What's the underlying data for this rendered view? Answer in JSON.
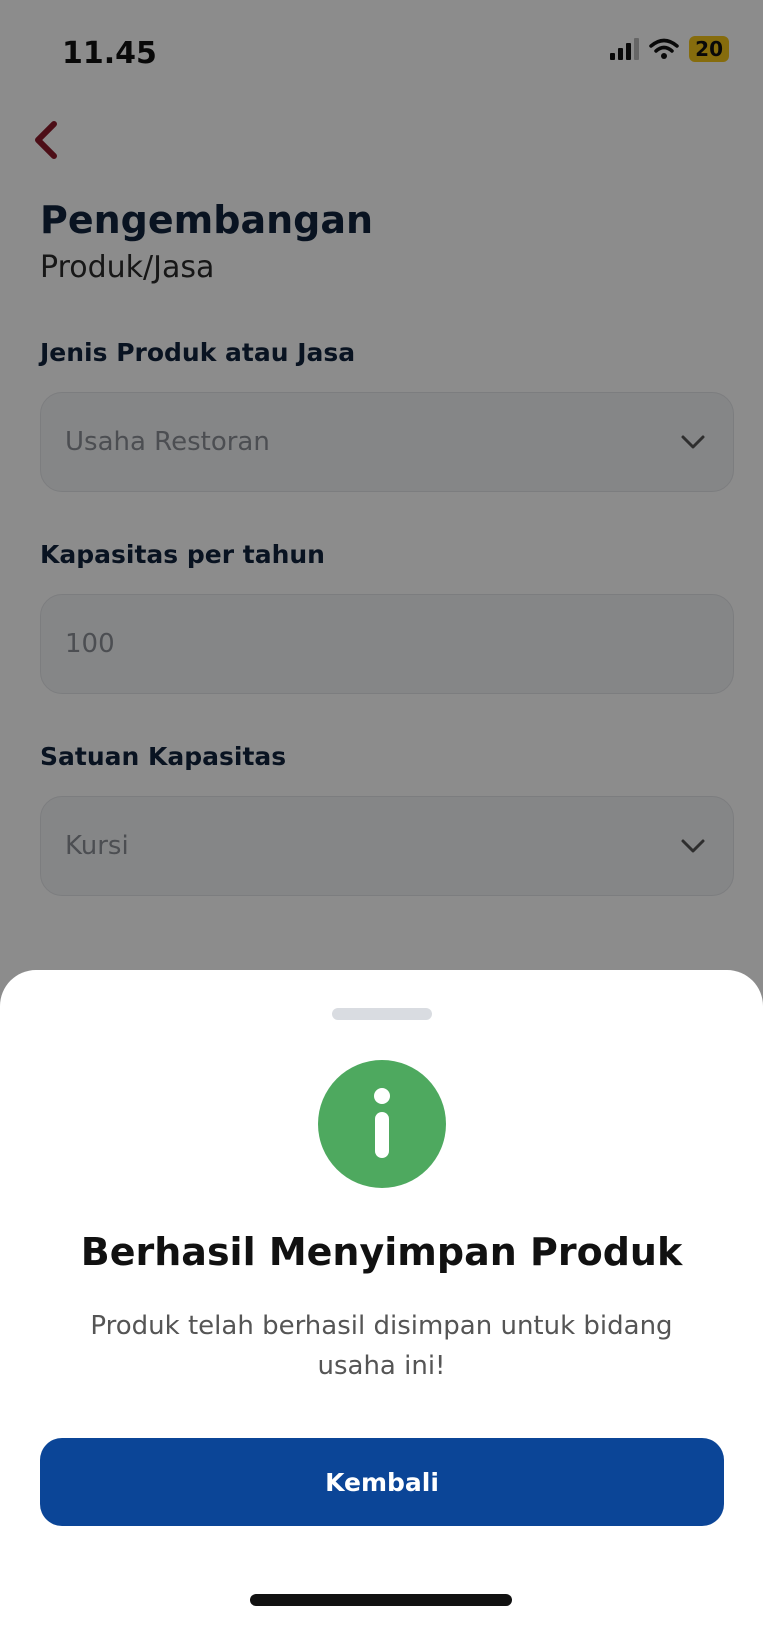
{
  "status_bar": {
    "time": "11.45",
    "battery": "20",
    "signal_icon": "signal-icon",
    "wifi_icon": "wifi-icon"
  },
  "header": {
    "back_icon": "chevron-left-icon",
    "title": "Pengembangan",
    "subtitle": "Produk/Jasa"
  },
  "form": {
    "jenis": {
      "label": "Jenis Produk atau Jasa",
      "value": "Usaha Restoran"
    },
    "kapasitas": {
      "label": "Kapasitas per tahun",
      "value": "100"
    },
    "satuan": {
      "label": "Satuan Kapasitas",
      "value": "Kursi"
    }
  },
  "sheet": {
    "icon": "info-icon",
    "title": "Berhasil Menyimpan Produk",
    "message": "Produk telah berhasil disimpan untuk bidang usaha ini!",
    "button_label": "Kembali"
  },
  "colors": {
    "accent_back": "#8b1a2b",
    "primary_button": "#0b4597",
    "success_icon": "#4ea95f",
    "title_text": "#12233d"
  }
}
